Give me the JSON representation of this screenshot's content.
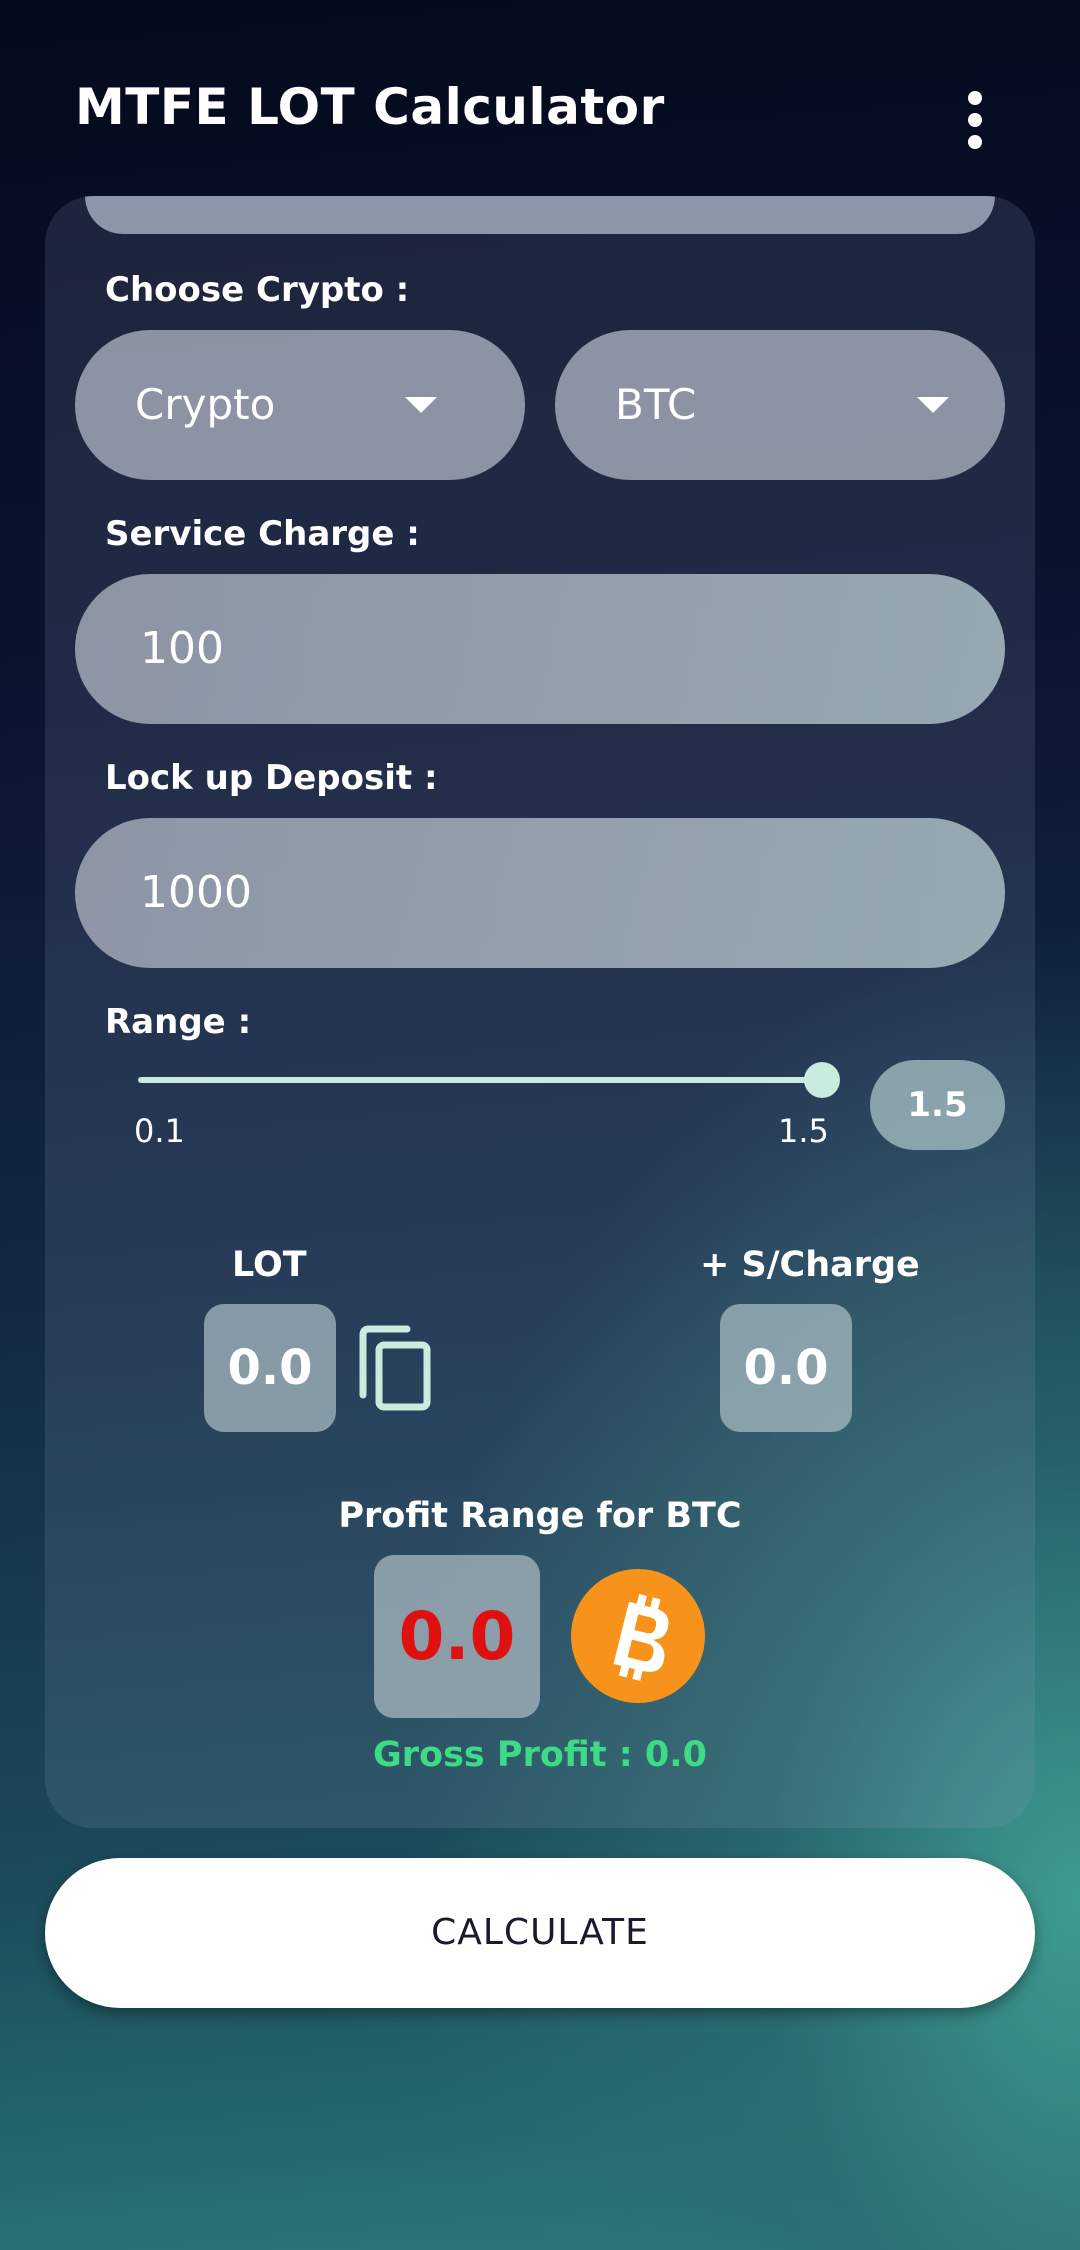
{
  "app": {
    "title": "MTFE LOT Calculator"
  },
  "crypto": {
    "label": "Choose Crypto :",
    "type_value": "Crypto",
    "coin_value": "BTC"
  },
  "service_charge": {
    "label": "Service Charge :",
    "value": "100"
  },
  "lockup_deposit": {
    "label": "Lock up Deposit :",
    "value": "1000"
  },
  "range": {
    "label": "Range :",
    "min": "0.1",
    "max": "1.5",
    "value": "1.5",
    "level": 1.5
  },
  "results": {
    "lot_label": "LOT",
    "lot_value": "0.0",
    "scharge_label": "+ S/Charge",
    "scharge_value": "0.0",
    "profit_label": "Profit Range for BTC",
    "profit_value": "0.0",
    "gross_profit": "Gross Profit : 0.0"
  },
  "actions": {
    "calculate": "CALCULATE"
  },
  "colors": {
    "profit_value": "#e01010",
    "gross_profit": "#3ddc84",
    "slider": "#c9ecdf",
    "bitcoin": "#f7931a"
  },
  "icons": {
    "menu": "more-vert-icon",
    "dropdown": "arrow-drop-down-icon",
    "copy": "content-copy-icon",
    "coin": "bitcoin-icon"
  }
}
